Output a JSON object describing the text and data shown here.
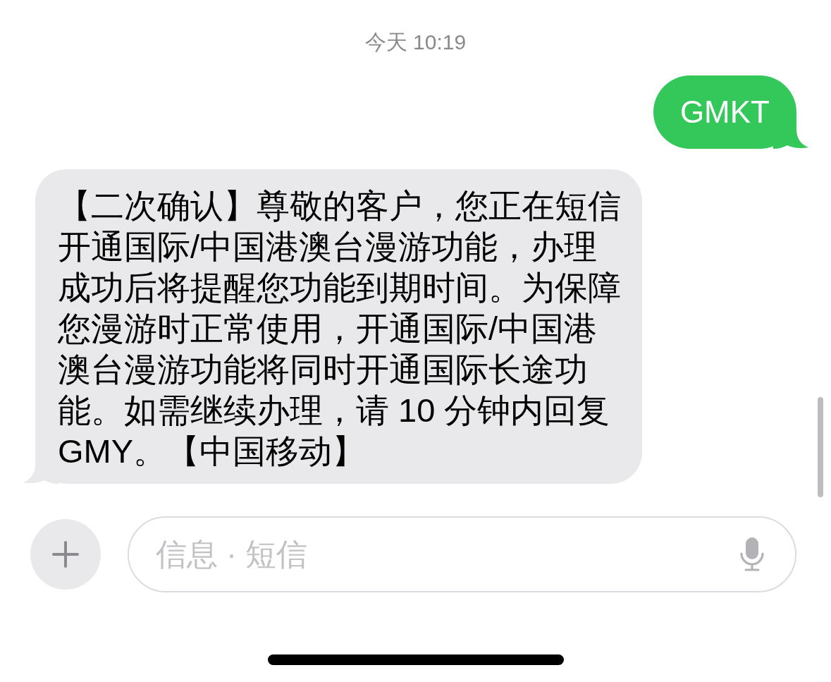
{
  "timestamp": "今天 10:19",
  "messages": [
    {
      "kind": "sent",
      "text": "GMKT"
    },
    {
      "kind": "received",
      "text": "【二次确认】尊敬的客户，您正在短信开通国际/中国港澳台漫游功能，办理成功后将提醒您功能到期时间。为保障您漫游时正常使用，开通国际/中国港澳台漫游功能将同时开通国际长途功能。如需继续办理，请 10 分钟内回复 GMY。【中国移动】"
    }
  ],
  "composer": {
    "placeholder": "信息 · 短信"
  }
}
